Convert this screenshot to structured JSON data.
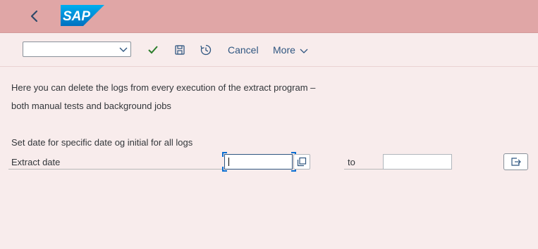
{
  "shell": {
    "logo_text": "SAP"
  },
  "toolbar": {
    "variant_select_value": "",
    "cancel_label": "Cancel",
    "more_label": "More"
  },
  "content": {
    "description_line1": "Here you can delete the logs from every execution of the extract program –",
    "description_line2": "both manual tests and background jobs",
    "instruction": "Set date for specific date og initial for all logs",
    "extract_date_label": "Extract date",
    "to_label": "to",
    "extract_date_from_value": "",
    "extract_date_to_value": ""
  },
  "colors": {
    "shell_bg": "#e0a6a6",
    "page_bg": "#f8ecec",
    "accent_text": "#2f5680",
    "checkmark": "#2b7d2b",
    "focus": "#0a6ed1"
  },
  "icons": [
    "back-arrow-icon",
    "sap-logo",
    "chevron-down-icon",
    "checkmark-icon",
    "save-icon",
    "history-icon",
    "value-help-icon",
    "multiple-selection-icon"
  ]
}
